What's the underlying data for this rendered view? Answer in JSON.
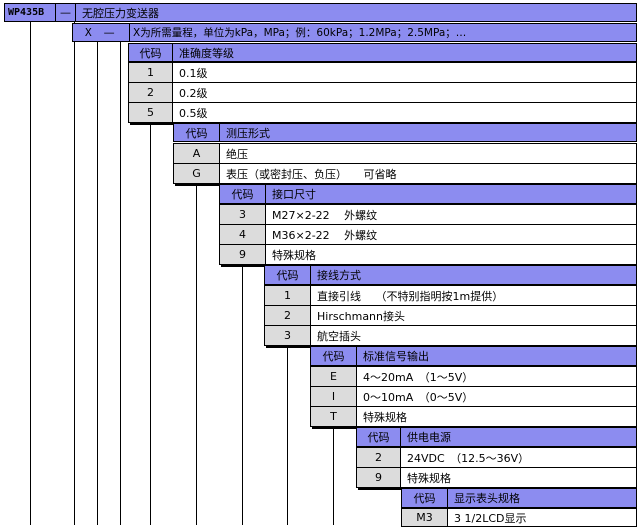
{
  "model": {
    "code": "WP435B",
    "dash": "—",
    "name": "无腔压力变送器"
  },
  "range": {
    "code": "X",
    "dash": "—",
    "desc": "X为所需量程，单位为kPa，MPa；例：60kPa；1.2MPa；2.5MPa；…"
  },
  "accuracy": {
    "header_code": "代码",
    "header_title": "准确度等级",
    "rows": [
      {
        "code": "1",
        "desc": "0.1级"
      },
      {
        "code": "2",
        "desc": "0.2级"
      },
      {
        "code": "5",
        "desc": "0.5级"
      }
    ]
  },
  "pressure_type": {
    "header_code": "代码",
    "header_title": "测压形式",
    "rows": [
      {
        "code": "A",
        "desc": "绝压"
      },
      {
        "code": "G",
        "desc": "表压（或密封压、负压）　　可省略"
      }
    ]
  },
  "port": {
    "header_code": "代码",
    "header_title": "接口尺寸",
    "rows": [
      {
        "code": "3",
        "desc": "M27×2-22　 外螺纹"
      },
      {
        "code": "4",
        "desc": "M36×2-22　 外螺纹"
      },
      {
        "code": "9",
        "desc": "特殊规格"
      }
    ]
  },
  "wiring": {
    "header_code": "代码",
    "header_title": "接线方式",
    "rows": [
      {
        "code": "1",
        "desc": "直接引线　 （不特别指明按1m提供）"
      },
      {
        "code": "2",
        "desc": "Hirschmann接头"
      },
      {
        "code": "3",
        "desc": "航空插头"
      }
    ]
  },
  "signal": {
    "header_code": "代码",
    "header_title": "标准信号输出",
    "rows": [
      {
        "code": "E",
        "desc": "4～20mA　（1～5V）"
      },
      {
        "code": "I",
        "desc": "0～10mA　（0～5V）"
      },
      {
        "code": "T",
        "desc": "特殊规格"
      }
    ]
  },
  "power": {
    "header_code": "代码",
    "header_title": "供电电源",
    "rows": [
      {
        "code": "2",
        "desc": "24VDC　（12.5～36V）"
      },
      {
        "code": "9",
        "desc": "特殊规格"
      }
    ]
  },
  "display": {
    "header_code": "代码",
    "header_title": "显示表头规格",
    "rows": [
      {
        "code": "M3",
        "desc": "3 1/2LCD显示"
      }
    ]
  }
}
